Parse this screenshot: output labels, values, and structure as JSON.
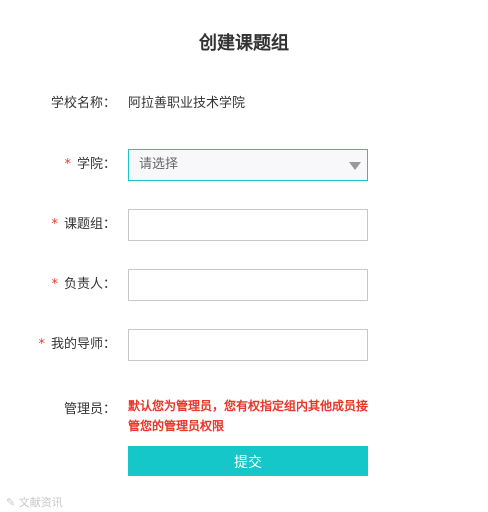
{
  "page": {
    "title": "创建课题组"
  },
  "form": {
    "school": {
      "label": "学校名称：",
      "value": "阿拉善职业技术学院"
    },
    "college": {
      "required_mark": "*",
      "label": "学院：",
      "placeholder": "请选择"
    },
    "group": {
      "required_mark": "*",
      "label": "课题组：",
      "value": ""
    },
    "owner": {
      "required_mark": "*",
      "label": "负责人：",
      "value": ""
    },
    "mentor": {
      "required_mark": "*",
      "label": "我的导师：",
      "value": ""
    },
    "admin": {
      "label": "管理员：",
      "notice": "默认您为管理员，您有权指定组内其他成员接管您的管理员权限"
    },
    "submit_label": "提交"
  },
  "watermark": {
    "text": "文献资讯"
  }
}
